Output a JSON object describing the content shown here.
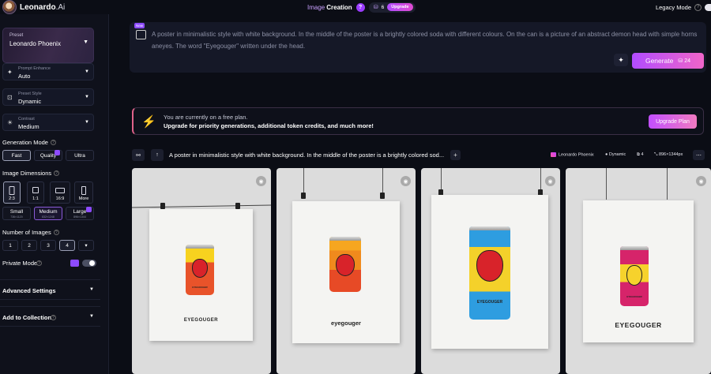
{
  "app": {
    "brand": "Leonardo",
    "brand_suffix": ".Ai",
    "title_prefix": "Image",
    "title": "Creation",
    "help": "?",
    "tokens": "6",
    "upgrade": "Upgrade",
    "legacy_mode": "Legacy Mode",
    "legacy_help": "?"
  },
  "sidebar": {
    "preset": {
      "label": "Preset",
      "value": "Leonardo Phoenix"
    },
    "prompt_enhance": {
      "label": "Prompt Enhance",
      "value": "Auto"
    },
    "preset_style": {
      "label": "Preset Style",
      "value": "Dynamic"
    },
    "contrast": {
      "label": "Contrast",
      "value": "Medium"
    },
    "generation_mode": {
      "label": "Generation Mode",
      "options": [
        "Fast",
        "Quality",
        "Ultra"
      ],
      "selected": "Fast"
    },
    "image_dimensions": {
      "label": "Image Dimensions",
      "ratios": [
        "2:3",
        "1:1",
        "16:9",
        "More"
      ],
      "selected_ratio": "2:3",
      "sizes": [
        {
          "name": "Small",
          "px": "736×1120"
        },
        {
          "name": "Medium",
          "px": "832×1248"
        },
        {
          "name": "Large",
          "px": "896×1344"
        }
      ],
      "selected_size": "Medium"
    },
    "number_of_images": {
      "label": "Number of Images",
      "options": [
        "1",
        "2",
        "3",
        "4"
      ],
      "selected": "4"
    },
    "private_mode": {
      "label": "Private Mode",
      "enabled": false
    },
    "advanced_settings": "Advanced Settings",
    "add_to_collection": "Add to Collection"
  },
  "prompt": {
    "new_badge": "New",
    "text": "A poster in minimalistic style with white background. In the middle of the poster is a brightly colored soda with different colours. On the can is a picture of an abstract demon head with simple horns aneyes.  The word \"Eyegouger\" written under the head.",
    "generate_label": "Generate",
    "generate_cost": "24"
  },
  "banner": {
    "line1": "You are currently on a free plan.",
    "line2": "Upgrade for priority generations, additional token credits, and much more!",
    "button": "Upgrade Plan"
  },
  "generation": {
    "prompt_preview": "A poster in minimalistic style with white background. In the middle of the poster is a brightly colored sod...",
    "model": "Leonardo Phoenix",
    "style": "Dynamic",
    "count": "4",
    "dimensions": "896×1344px",
    "images": [
      {
        "word": "EYEGOUGER"
      },
      {
        "word": "eyegouger"
      },
      {
        "word": "EYEGOUGER"
      },
      {
        "word": "EYEGOUGER"
      }
    ]
  },
  "colors": {
    "accent_gradient_start": "#b14cff",
    "accent_gradient_end": "#f065c8",
    "background": "#0b0d15",
    "sidebar": "#0f111b"
  }
}
